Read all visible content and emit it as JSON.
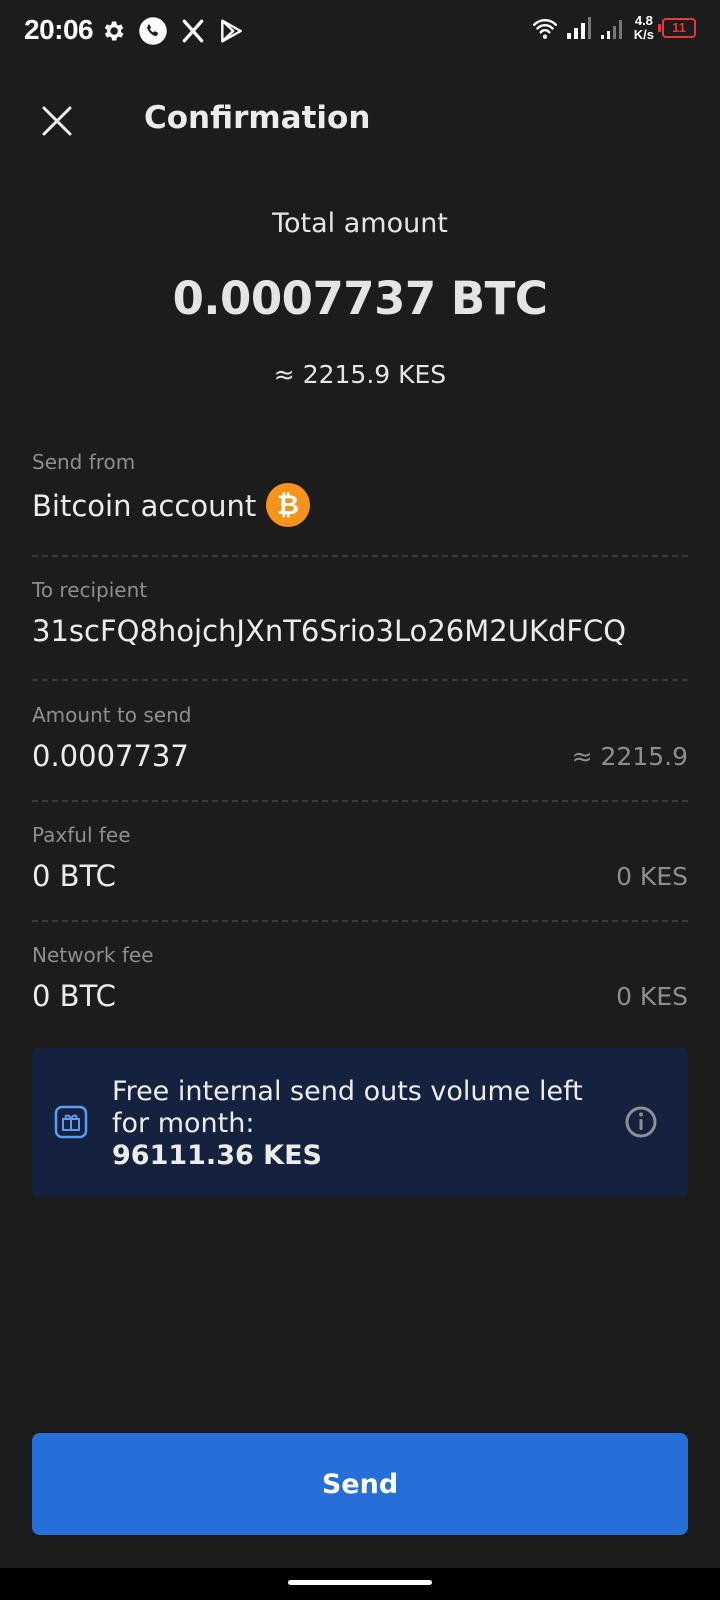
{
  "status_bar": {
    "time": "20:06",
    "net_speed_value": "4.8",
    "net_speed_unit": "K/s",
    "battery_level": "11"
  },
  "header": {
    "title": "Confirmation"
  },
  "summary": {
    "total_label": "Total amount",
    "total_amount": "0.0007737 BTC",
    "total_fiat": "≈ 2215.9 KES"
  },
  "details": {
    "send_from_label": "Send from",
    "send_from_value": "Bitcoin account",
    "to_recipient_label": "To recipient",
    "to_recipient_value": "31scFQ8hojchJXnT6Srio3Lo26M2UKdFCQ",
    "amount_label": "Amount to send",
    "amount_value": "0.0007737",
    "amount_fiat": "≈ 2215.9",
    "paxful_fee_label": "Paxful fee",
    "paxful_fee_value": "0 BTC",
    "paxful_fee_fiat": "0 KES",
    "network_fee_label": "Network fee",
    "network_fee_value": "0 BTC",
    "network_fee_fiat": "0 KES"
  },
  "info_box": {
    "text": "Free internal send outs volume left for month:",
    "value": "96111.36 KES"
  },
  "send_button": {
    "label": "Send"
  },
  "icons": {
    "status_left": [
      "gear-icon",
      "whatsapp-icon",
      "x-icon",
      "play-store-icon"
    ],
    "status_right": [
      "wifi-icon",
      "signal-icon",
      "signal-icon",
      "battery-icon"
    ],
    "close": "close-icon",
    "coin": "bitcoin-icon",
    "gift": "gift-icon",
    "info": "info-icon"
  },
  "colors": {
    "background": "#1c1c1d",
    "accent": "#266fd8",
    "bitcoin": "#f7931a",
    "info_box": "#15223f",
    "battery_low": "#e53935"
  }
}
